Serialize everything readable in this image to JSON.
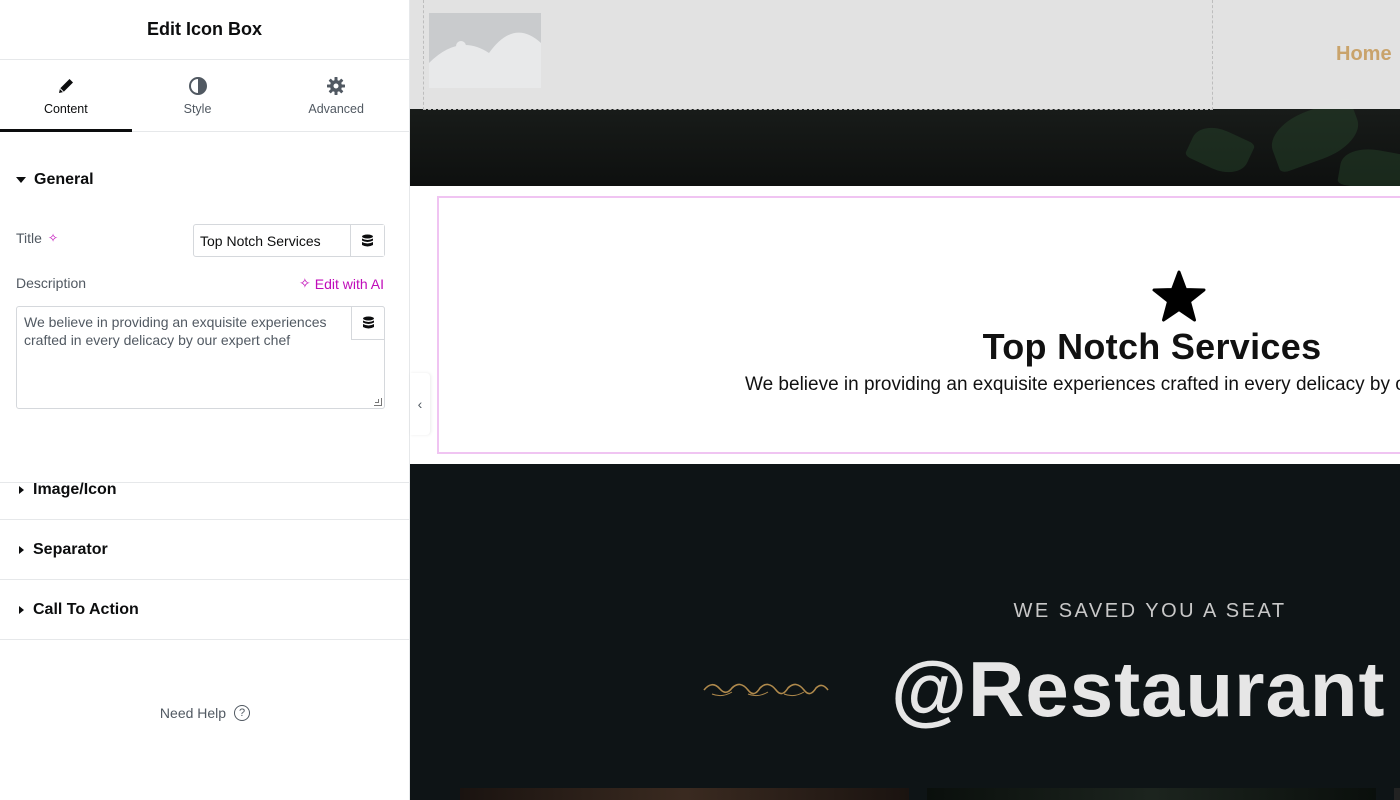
{
  "panel": {
    "title": "Edit Icon Box",
    "tabs": [
      {
        "label": "Content",
        "icon": "pencil-icon",
        "active": true
      },
      {
        "label": "Style",
        "icon": "half-circle-icon",
        "active": false
      },
      {
        "label": "Advanced",
        "icon": "gear-icon",
        "active": false
      }
    ],
    "general": {
      "label": "General",
      "title_label": "Title",
      "title_value": "Top Notch Services",
      "description_label": "Description",
      "edit_ai_label": "Edit with AI",
      "description_value": "We believe in providing an exquisite experiences crafted in every delicacy by our expert chef"
    },
    "sections": [
      {
        "label": "Image/Icon"
      },
      {
        "label": "Separator"
      },
      {
        "label": "Call To Action"
      }
    ],
    "need_help": "Need Help",
    "help_glyph": "?",
    "collapse_glyph": "‹"
  },
  "preview": {
    "nav_home": "Home",
    "iconbox_title": "Top Notch Services",
    "iconbox_desc": "We believe in providing an exquisite experiences crafted in every delicacy by our expert chef",
    "seat_text": "WE SAVED YOU A SEAT",
    "handle_text": "@Restaurant"
  },
  "colors": {
    "ai_accent": "#c00bb9",
    "nav_gold": "#c9a36b",
    "iconbox_outline": "#f0c4f2",
    "dark_bg": "#0e1416"
  }
}
